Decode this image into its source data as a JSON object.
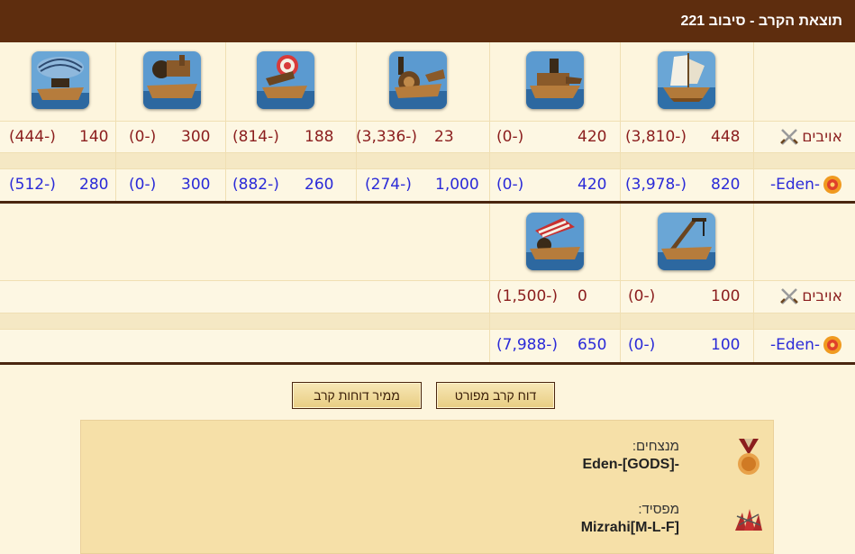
{
  "header": {
    "title": "תוצאת הקרב - סיבוב 221"
  },
  "rows_label": {
    "enemies": "אויבים",
    "self": "-Eden-"
  },
  "table1": {
    "enemies": [
      {
        "value": "448",
        "loss": "(3,810-)"
      },
      {
        "value": "420",
        "loss": "(0-)"
      },
      {
        "value": "23",
        "loss": "(3,336-)"
      },
      {
        "value": "188",
        "loss": "(814-)"
      },
      {
        "value": "300",
        "loss": "(0-)"
      },
      {
        "value": "140",
        "loss": "(444-)"
      }
    ],
    "self": [
      {
        "value": "820",
        "loss": "(3,978-)"
      },
      {
        "value": "420",
        "loss": "(0-)"
      },
      {
        "value": "1,000",
        "loss": "(274-)"
      },
      {
        "value": "260",
        "loss": "(882-)"
      },
      {
        "value": "300",
        "loss": "(0-)"
      },
      {
        "value": "280",
        "loss": "(512-)"
      }
    ]
  },
  "table2": {
    "enemies": [
      {
        "value": "100",
        "loss": "(0-)"
      },
      {
        "value": "0",
        "loss": "(1,500-)"
      }
    ],
    "self": [
      {
        "value": "100",
        "loss": "(0-)"
      },
      {
        "value": "650",
        "loss": "(7,988-)"
      }
    ]
  },
  "unit_icons": [
    "sail-ship-icon",
    "steam-ram-icon",
    "paddle-wheel-ram-icon",
    "rocket-ship-icon",
    "mortar-ship-icon",
    "balloon-carrier-icon",
    "crane-ship-icon",
    "fire-ship-icon"
  ],
  "buttons": {
    "detailed_report": "דוח קרב מפורט",
    "converter": "ממיר דוחות קרב"
  },
  "summary": {
    "winners_label": "מנצחים:",
    "winners_value": "Eden-[GODS]-",
    "loser_label": "מפסיד:",
    "loser_value": "Mizrahi[M-L-F]"
  },
  "colors": {
    "header_bg": "#5e2d0e",
    "enemy_text": "#8b1e1e",
    "self_text": "#2a2ad8",
    "summary_bg": "#f6e0a8"
  }
}
